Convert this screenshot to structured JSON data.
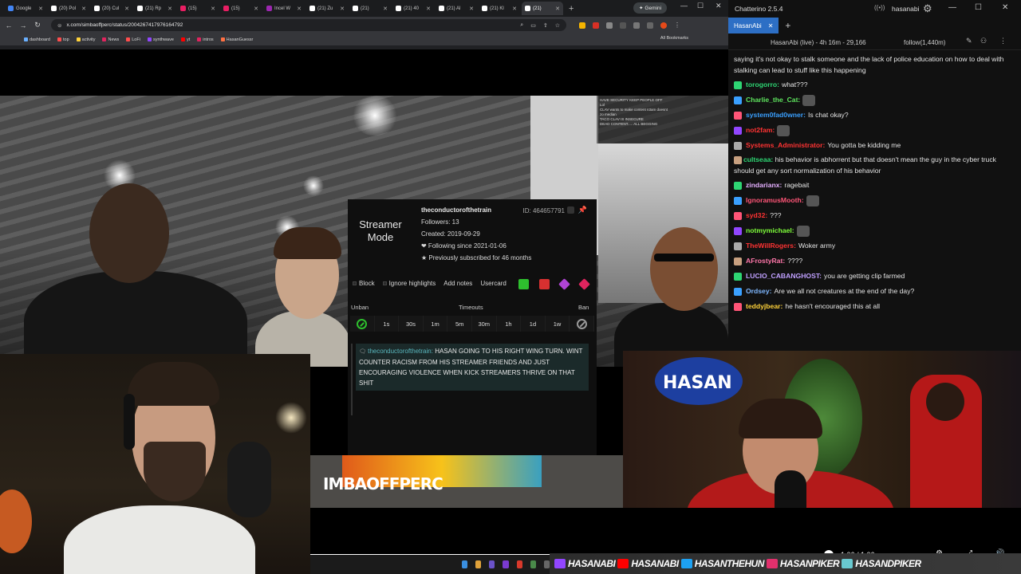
{
  "browser": {
    "tabs": [
      {
        "label": "Google",
        "color": "#4285f4"
      },
      {
        "label": "(20) Pol",
        "color": "#ffffff"
      },
      {
        "label": "(20) Cul",
        "color": "#ffffff"
      },
      {
        "label": "(21) Rp",
        "color": "#ffffff"
      },
      {
        "label": "(15)",
        "color": "#e91e63"
      },
      {
        "label": "(15)",
        "color": "#e91e63"
      },
      {
        "label": "Incel W",
        "color": "#9c27b0"
      },
      {
        "label": "(21) Zu",
        "color": "#ffffff"
      },
      {
        "label": "(21)",
        "color": "#ffffff"
      },
      {
        "label": "(21) 40",
        "color": "#ffffff"
      },
      {
        "label": "(21) Al",
        "color": "#ffffff"
      },
      {
        "label": "(21) Kl",
        "color": "#ffffff"
      },
      {
        "label": "(21)",
        "color": "#ffffff",
        "active": true
      }
    ],
    "gemini_label": "Gemini",
    "url": "x.com/simbaoffperc/status/2004267417976164792",
    "bookmarks": [
      "dashboard",
      "top",
      "activity",
      "News",
      "LoFi",
      "synthwave",
      "yt",
      "intros",
      "HasanGuessr"
    ],
    "all_bookmarks": "All Bookmarks"
  },
  "video": {
    "overlay_chat": [
      "HAVE SECURITY KEEP PEOPLE OFF",
      "Lol",
      "CLAV wants to make content n3am doesnt",
      "zo median",
      "TACO  CLAV IS INSECURE",
      "DEAD CONTENT..... ALL BEGGING"
    ],
    "watermark": "IMBAOFFPERC"
  },
  "streamer_mode": "Streamer Mode",
  "user_popup": {
    "username": "theconductorofthetrain",
    "id": "ID: 464657791",
    "followers": "Followers: 13",
    "created": "Created: 2019-09-29",
    "following": "❤ Following since 2021-01-06",
    "subscribed": "★ Previously subscribed for 46 months",
    "block": "Block",
    "ignore": "Ignore highlights",
    "add_notes": "Add notes",
    "usercard": "Usercard",
    "unban": "Unban",
    "timeouts": "Timeouts",
    "ban": "Ban",
    "durations": [
      "1s",
      "30s",
      "1m",
      "5m",
      "30m",
      "1h",
      "1d",
      "1w"
    ],
    "message_author": "theconductorofthetrain:",
    "message_text": "HASAN GOING TO HIS RIGHT WING TURN. WINT COUNTER RACISM FROM HIS STREAMER FRIENDS AND JUST ENCOURAGING VIOLENCE WHEN KICK STREAMERS THRIVE ON THAT SHIT"
  },
  "chatterino": {
    "title": "Chatterino 2.5.4",
    "user": "hasanabi",
    "tab": "HasanAbi",
    "split_title": "HasanAbi (live) - 4h 16m - 29,166",
    "follow": "follow(1,440m)",
    "messages": [
      {
        "name": "",
        "text": "saying it's not okay to stalk someone and the lack of police education on how to deal with stalking can lead to stuff like this happening",
        "color": "#e5e5e5"
      },
      {
        "name": "torogorro:",
        "text": "what???",
        "color": "#2ed573"
      },
      {
        "name": "Charlie_the_Cat:",
        "text": "",
        "color": "#5ee55e"
      },
      {
        "name": "system0fad0wner:",
        "text": "Is chat okay?",
        "color": "#3aa0ff"
      },
      {
        "name": "not2fam:",
        "text": "",
        "color": "#ff3333"
      },
      {
        "name": "Systems_Administrator:",
        "text": "You gotta be kidding me",
        "color": "#ff3333"
      },
      {
        "name": "cultseaa:",
        "text": "his behavior is abhorrent but that doesn't mean the guy in the cyber truck should get any sort normalization of his behavior",
        "color": "#2ed573"
      },
      {
        "name": "zindarianx:",
        "text": "ragebait",
        "color": "#e5b0ff"
      },
      {
        "name": "IgnoramusMooth:",
        "text": "",
        "color": "#ff5577"
      },
      {
        "name": "syd32:",
        "text": "???",
        "color": "#ff3333"
      },
      {
        "name": "notmymichael:",
        "text": "",
        "color": "#7fff3a"
      },
      {
        "name": "TheWillRogers:",
        "text": "Woker army",
        "color": "#ff3333"
      },
      {
        "name": "AFrostyRat:",
        "text": "????",
        "color": "#ff77aa"
      },
      {
        "name": "LUCIO_CABANGHOST:",
        "text": "you are getting clip farmed",
        "color": "#c0a0ff"
      },
      {
        "name": "Ordsey:",
        "text": "Are we all not creatures at the end of the day?",
        "color": "#7fb8ff"
      },
      {
        "name": "teddyjbear:",
        "text": "he hasn't encouraged this at all",
        "color": "#ffd23a"
      }
    ]
  },
  "player": {
    "time": "1:06 / 1:06",
    "progress": 0.73
  },
  "banner": [
    {
      "name": "HASANABI",
      "color": "#9146ff"
    },
    {
      "name": "HASANABI",
      "color": "#ff0000"
    },
    {
      "name": "HASANTHEHUN",
      "color": "#1da1f2"
    },
    {
      "name": "HASANPIKER",
      "color": "#e1306c"
    },
    {
      "name": "HASANDPIKER",
      "color": "#69c9d0"
    }
  ]
}
